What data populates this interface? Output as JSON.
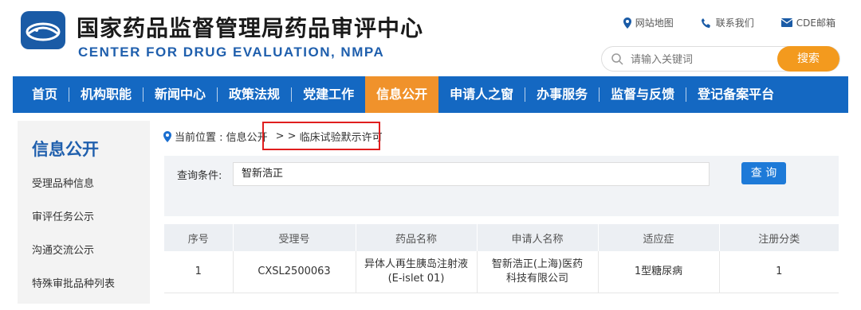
{
  "header": {
    "title_cn": "国家药品监督管理局药品审评中心",
    "title_en": "CENTER FOR DRUG EVALUATION, NMPA",
    "links": [
      {
        "label": "网站地图",
        "icon": "location-pin-icon"
      },
      {
        "label": "联系我们",
        "icon": "phone-icon"
      },
      {
        "label": "CDE邮箱",
        "icon": "mail-icon"
      }
    ],
    "search_placeholder": "请输入关键词",
    "search_button": "搜索"
  },
  "nav": {
    "items": [
      "首页",
      "机构职能",
      "新闻中心",
      "政策法规",
      "党建工作",
      "信息公开",
      "申请人之窗",
      "办事服务",
      "监督与反馈",
      "登记备案平台"
    ],
    "active": "信息公开"
  },
  "sidebar": {
    "title": "信息公开",
    "items": [
      "受理品种信息",
      "审评任务公示",
      "沟通交流公示",
      "特殊审批品种列表"
    ]
  },
  "breadcrumb": {
    "prefix": "当前位置 : 信息公开",
    "sep": "> >",
    "current": "临床试验默示许可"
  },
  "query": {
    "label": "查询条件:",
    "value": "智新浩正",
    "button": "查 询"
  },
  "table": {
    "headers": [
      "序号",
      "受理号",
      "药品名称",
      "申请人名称",
      "适应症",
      "注册分类"
    ],
    "rows": [
      {
        "no": "1",
        "accept_no": "CXSL2500063",
        "drug_line1": "异体人再生胰岛注射液",
        "drug_line2": "(E-islet 01)",
        "applicant_line1": "智新浩正(上海)医药",
        "applicant_line2": "科技有限公司",
        "indication": "1型糖尿病",
        "category": "1"
      }
    ]
  },
  "colors": {
    "nav_blue": "#1468c2",
    "nav_active": "#f0922b",
    "brand_blue": "#1f5fad",
    "highlight_red": "#e01e1e",
    "search_orange": "#f39a1e"
  }
}
